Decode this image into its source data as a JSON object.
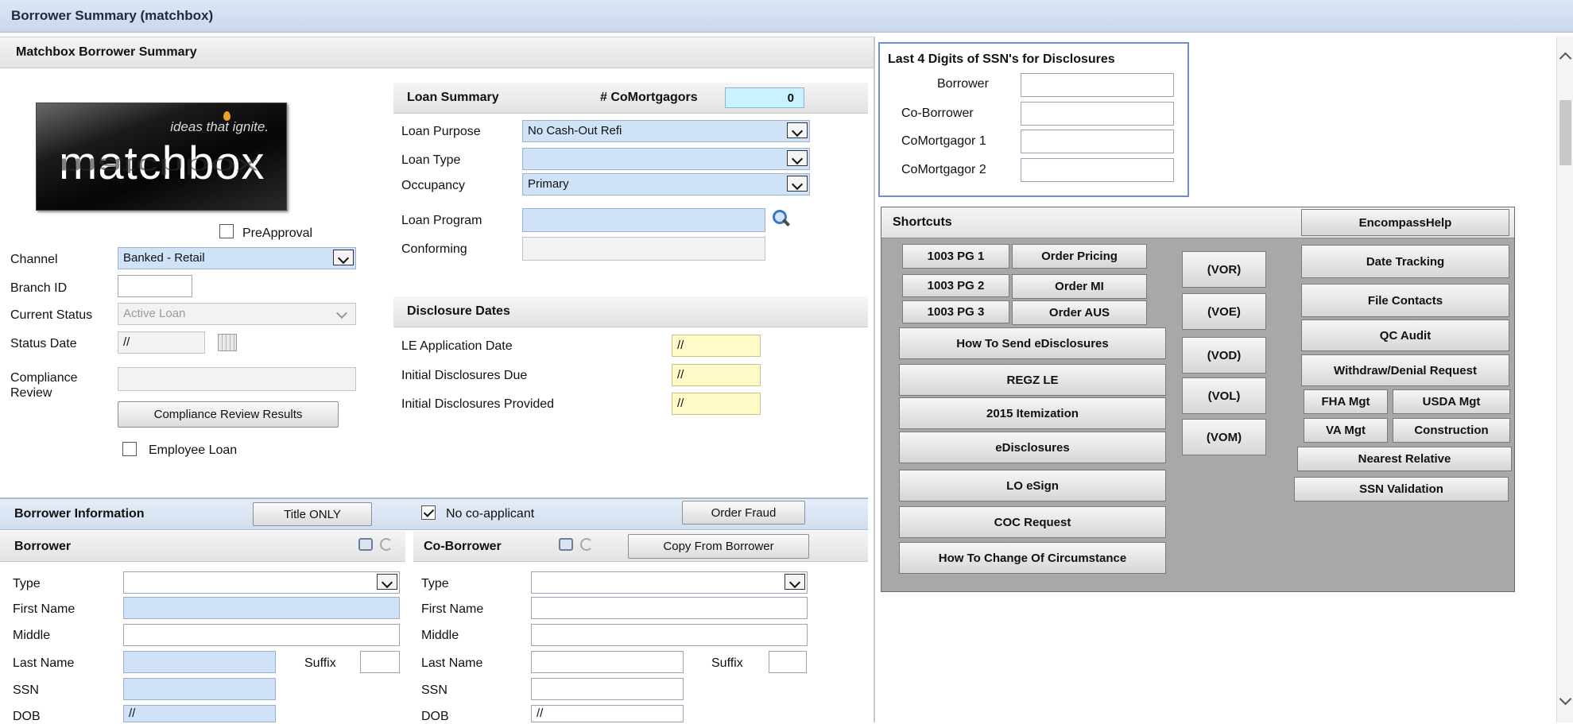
{
  "window": {
    "title": "Borrower Summary (matchbox)"
  },
  "summary": {
    "title": "Matchbox Borrower Summary",
    "logo": {
      "tagline": "ideas that ignite.",
      "wordmark": "matchbox"
    },
    "preapproval_label": "PreApproval",
    "channel_label": "Channel",
    "channel_value": "Banked - Retail",
    "branch_label": "Branch ID",
    "status_label": "Current Status",
    "status_value": "Active Loan",
    "status_date_label": "Status Date",
    "status_date_value": "//",
    "compliance_label": "Compliance Review",
    "compliance_button": "Compliance Review Results",
    "employee_loan_label": "Employee Loan"
  },
  "loan_summary": {
    "title": "Loan Summary",
    "comortgagors_label": "# CoMortgagors",
    "comortgagors_value": "0",
    "purpose_label": "Loan Purpose",
    "purpose_value": "No Cash-Out Refi",
    "type_label": "Loan Type",
    "type_value": "",
    "occupancy_label": "Occupancy",
    "occupancy_value": "Primary",
    "program_label": "Loan Program",
    "conforming_label": "Conforming"
  },
  "disclosure_dates": {
    "title": "Disclosure Dates",
    "rows": [
      {
        "label": "LE Application Date",
        "value": "//"
      },
      {
        "label": "Initial Disclosures Due",
        "value": "//"
      },
      {
        "label": "Initial Disclosures Provided",
        "value": "//"
      }
    ]
  },
  "ssn_panel": {
    "title": "Last 4 Digits of SSN's for Disclosures",
    "rows": [
      {
        "label": "Borrower"
      },
      {
        "label": "Co-Borrower"
      },
      {
        "label": "CoMortgagor 1"
      },
      {
        "label": "CoMortgagor 2"
      }
    ]
  },
  "shortcuts": {
    "title": "Shortcuts",
    "encompass_help": "EncompassHelp",
    "pg1": "1003 PG 1",
    "pg2": "1003 PG 2",
    "pg3": "1003 PG 3",
    "order_pricing": "Order Pricing",
    "order_mi": "Order MI",
    "order_aus": "Order AUS",
    "how_send": "How To Send eDisclosures",
    "regz": "REGZ LE",
    "itemization": "2015 Itemization",
    "edisclosures": "eDisclosures",
    "lo_esign": "LO eSign",
    "coc": "COC Request",
    "how_change": "How To Change Of Circumstance",
    "vor": "(VOR)",
    "voe": "(VOE)",
    "vod": "(VOD)",
    "vol": "(VOL)",
    "vom": "(VOM)",
    "date_tracking": "Date Tracking",
    "file_contacts": "File Contacts",
    "qc_audit": "QC Audit",
    "withdraw": "Withdraw/Denial Request",
    "fha": "FHA Mgt",
    "usda": "USDA Mgt",
    "va": "VA Mgt",
    "construction": "Construction",
    "nearest": "Nearest Relative",
    "ssn_validation": "SSN Validation"
  },
  "borrower_info": {
    "title": "Borrower Information",
    "title_only_button": "Title ONLY",
    "no_coapplicant_label": "No co-applicant",
    "order_fraud_button": "Order Fraud",
    "borrower": {
      "title": "Borrower",
      "type_label": "Type",
      "first_label": "First Name",
      "middle_label": "Middle",
      "last_label": "Last Name",
      "suffix_label": "Suffix",
      "ssn_label": "SSN",
      "dob_label": "DOB",
      "dob_value": "//"
    },
    "coborrower": {
      "title": "Co-Borrower",
      "copy_button": "Copy From Borrower",
      "type_label": "Type",
      "first_label": "First Name",
      "middle_label": "Middle",
      "last_label": "Last Name",
      "suffix_label": "Suffix",
      "ssn_label": "SSN",
      "dob_label": "DOB",
      "dob_value": "//"
    }
  },
  "icons": [
    "search-icon",
    "calendar-icon",
    "address-book-icon",
    "sync-icon",
    "scroll-up-icon",
    "scroll-down-icon"
  ]
}
